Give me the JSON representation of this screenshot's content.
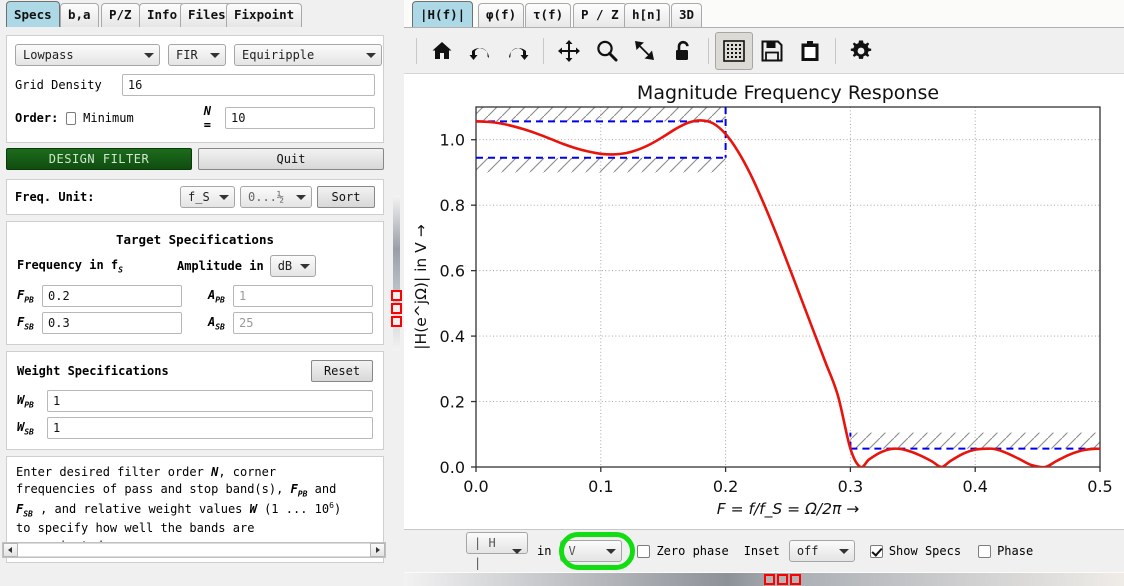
{
  "left": {
    "tabs": [
      {
        "label": "Specs",
        "active": true
      },
      {
        "label": "b,a",
        "active": false
      },
      {
        "label": "P/Z",
        "active": false
      },
      {
        "label": "Info",
        "active": false
      },
      {
        "label": "Files",
        "active": false
      },
      {
        "label": "Fixpoint",
        "active": false
      }
    ],
    "response_type": "Lowpass",
    "filter_class": "FIR",
    "design_method": "Equiripple",
    "grid_density_label": "Grid Density",
    "grid_density_value": "16",
    "order_label": "Order:",
    "minimum_label": "Minimum",
    "minimum_checked": false,
    "n_label": "N =",
    "n_value": "10",
    "design_button": "DESIGN FILTER",
    "quit_button": "Quit",
    "freq_unit_label": "Freq. Unit:",
    "freq_unit_value": "f_S",
    "freq_range_value": "0...½",
    "sort_button": "Sort",
    "target_specs_title": "Target Specifications",
    "frequency_header": "Frequency in f",
    "frequency_header_sub": "S",
    "amplitude_header": "Amplitude in",
    "amplitude_unit": "dB",
    "f_pb_label_main": "F",
    "f_pb_label_sub": "PB",
    "f_pb_value": "0.2",
    "f_sb_label_main": "F",
    "f_sb_label_sub": "SB",
    "f_sb_value": "0.3",
    "a_pb_label_main": "A",
    "a_pb_label_sub": "PB",
    "a_pb_value": "1",
    "a_sb_label_main": "A",
    "a_sb_label_sub": "SB",
    "a_sb_value": "25",
    "weight_specs_title": "Weight Specifications",
    "reset_button": "Reset",
    "w_pb_label_main": "W",
    "w_pb_label_sub": "PB",
    "w_pb_value": "1",
    "w_sb_label_main": "W",
    "w_sb_label_sub": "SB",
    "w_sb_value": "1",
    "help_text_line1": "Enter desired filter order ",
    "help_n": "N",
    "help_text_line1b": ", corner",
    "help_text_line2": "frequencies of pass and stop band(s), ",
    "help_fpb": "F",
    "help_fpb_sub": "PB",
    "help_text_line2b": " and",
    "help_fsb": "F",
    "help_fsb_sub": "SB",
    "help_text_line3": " , and relative weight values ",
    "help_w": "W",
    "help_text_line3b": " (1 ... 10",
    "help_exp": "6",
    "help_text_line3c": ")",
    "help_text_line4": "to specify how well the bands are",
    "help_text_line5": "approximated."
  },
  "right": {
    "tabs": [
      {
        "label": "|H(f)|",
        "active": true
      },
      {
        "label": "φ(f)",
        "active": false
      },
      {
        "label": "τ(f)",
        "active": false
      },
      {
        "label": "P / Z",
        "active": false
      },
      {
        "label": "h[n]",
        "active": false
      },
      {
        "label": "3D",
        "active": false
      }
    ],
    "toolbar": [
      {
        "name": "home-icon",
        "pressed": false
      },
      {
        "name": "back-arrow-icon",
        "pressed": false
      },
      {
        "name": "forward-arrow-icon",
        "pressed": false
      },
      {
        "name": "pan-move-icon",
        "pressed": false
      },
      {
        "name": "zoom-magnifier-icon",
        "pressed": false
      },
      {
        "name": "resize-icon",
        "pressed": false
      },
      {
        "name": "unlock-icon",
        "pressed": false
      },
      {
        "name": "grid-icon",
        "pressed": true
      },
      {
        "name": "save-floppy-icon",
        "pressed": false
      },
      {
        "name": "clipboard-icon",
        "pressed": false
      },
      {
        "name": "gear-icon",
        "pressed": false
      }
    ],
    "bottom": {
      "magnitude_select": "| H |",
      "in_label": "in",
      "unit_select": "V",
      "zero_phase_label": "Zero phase",
      "zero_phase_checked": false,
      "inset_label": "Inset",
      "inset_select": "off",
      "show_specs_label": "Show Specs",
      "show_specs_checked": true,
      "phase_label": "Phase",
      "phase_checked": false
    }
  },
  "chart_data": {
    "type": "line",
    "title": "Magnitude Frequency Response",
    "xlabel": "F = f/f_S = Ω/2π →",
    "ylabel": "|H(e^jΩ)| in V →",
    "xlim": [
      0.0,
      0.5
    ],
    "ylim": [
      0.0,
      1.1
    ],
    "xticks": [
      "0.0",
      "0.1",
      "0.2",
      "0.3",
      "0.4",
      "0.5"
    ],
    "xtick_values": [
      0.0,
      0.1,
      0.2,
      0.3,
      0.4,
      0.5
    ],
    "yticks": [
      "0.0",
      "0.2",
      "0.4",
      "0.6",
      "0.8",
      "1.0"
    ],
    "ytick_values": [
      0.0,
      0.2,
      0.4,
      0.6,
      0.8,
      1.0
    ],
    "grid": true,
    "series": [
      {
        "name": "|H(f)|",
        "color": "#e8140c",
        "x": [
          0.0,
          0.01,
          0.02,
          0.03,
          0.04,
          0.05,
          0.06,
          0.07,
          0.08,
          0.09,
          0.1,
          0.11,
          0.12,
          0.13,
          0.14,
          0.15,
          0.16,
          0.17,
          0.18,
          0.19,
          0.2,
          0.21,
          0.22,
          0.23,
          0.24,
          0.25,
          0.26,
          0.27,
          0.28,
          0.29,
          0.3,
          0.308,
          0.315,
          0.325,
          0.335,
          0.345,
          0.355,
          0.365,
          0.373,
          0.38,
          0.39,
          0.4,
          0.41,
          0.416,
          0.425,
          0.435,
          0.445,
          0.456,
          0.465,
          0.475,
          0.485,
          0.492,
          0.5
        ],
        "y": [
          1.056,
          1.0545,
          1.0495,
          1.041,
          1.03,
          1.017,
          1.002,
          0.987,
          0.974,
          0.964,
          0.957,
          0.955,
          0.959,
          0.97,
          0.987,
          1.009,
          1.033,
          1.052,
          1.059,
          1.05,
          1.0175,
          0.964,
          0.894,
          0.81,
          0.718,
          0.62,
          0.52,
          0.42,
          0.32,
          0.218,
          0.056,
          0.0,
          0.023,
          0.046,
          0.056,
          0.051,
          0.037,
          0.018,
          0.0,
          0.018,
          0.04,
          0.053,
          0.056,
          0.0545,
          0.043,
          0.025,
          0.006,
          0.0,
          0.018,
          0.037,
          0.05,
          0.0545,
          0.056
        ]
      }
    ],
    "spec_lines": {
      "color": "#0000ee",
      "passband_upper": 1.056,
      "passband_lower": 0.945,
      "passband_f_start": 0.0,
      "passband_f_end": 0.2,
      "stopband_level": 0.056,
      "stopband_f_start": 0.3,
      "stopband_f_end": 0.5
    },
    "hatch_regions": [
      {
        "name": "passband-upper-forbidden",
        "f_start": 0.0,
        "f_end": 0.2,
        "y_from": 1.056,
        "y_to": 1.1
      },
      {
        "name": "passband-lower-forbidden",
        "f_start": 0.0,
        "f_end": 0.2,
        "y_from": 0.9,
        "y_to": 0.945
      },
      {
        "name": "stopband-forbidden",
        "f_start": 0.3,
        "f_end": 0.5,
        "y_from": 0.056,
        "y_to": 0.105
      }
    ]
  }
}
